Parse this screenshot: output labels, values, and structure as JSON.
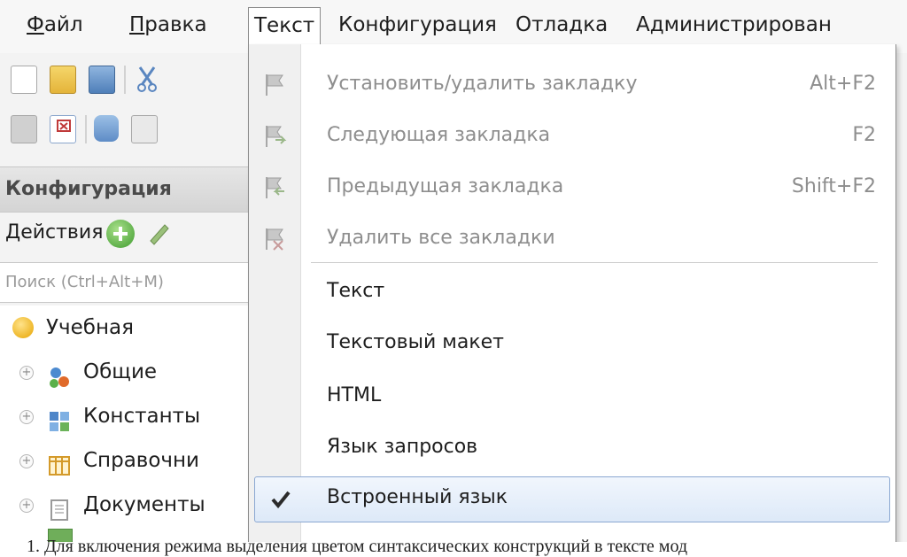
{
  "menubar": {
    "items": [
      {
        "label_ul": "Ф",
        "label_rest": "айл"
      },
      {
        "label_ul": "П",
        "label_rest": "равка"
      },
      {
        "label": "Текст"
      },
      {
        "label": "Конфигурация"
      },
      {
        "label": "Отладка"
      },
      {
        "label": "Администрирован"
      }
    ]
  },
  "sidebar": {
    "header": "Конфигурация",
    "actions_label": "Действия",
    "actions_arrow": "▾",
    "search_placeholder": "Поиск (Ctrl+Alt+M)",
    "tree": {
      "root": "Учебная",
      "items": [
        "Общие",
        "Константы",
        "Справочни",
        "Документы"
      ],
      "expand_glyph": "+"
    }
  },
  "dropdown": {
    "items": [
      {
        "label": "Установить/удалить закладку",
        "shortcut": "Alt+F2",
        "icon": "bookmark-toggle-icon"
      },
      {
        "label": "Следующая закладка",
        "shortcut": "F2",
        "icon": "bookmark-next-icon"
      },
      {
        "label": "Предыдущая закладка",
        "shortcut": "Shift+F2",
        "icon": "bookmark-prev-icon"
      },
      {
        "label": "Удалить все закладки",
        "shortcut": "",
        "icon": "bookmark-delete-all-icon"
      },
      {
        "label": "Текст"
      },
      {
        "label": "Текстовый макет"
      },
      {
        "label": "HTML"
      },
      {
        "label": "Язык запросов"
      },
      {
        "label": "Встроенный язык",
        "checked": true
      }
    ]
  },
  "caption": "1. Для включения режима выделения цветом синтаксических конструкций в тексте мод",
  "colors": {
    "highlight_border": "#8ba8d2",
    "highlight_fill": "#dde9f8",
    "disabled_text": "#8e8e8e"
  }
}
